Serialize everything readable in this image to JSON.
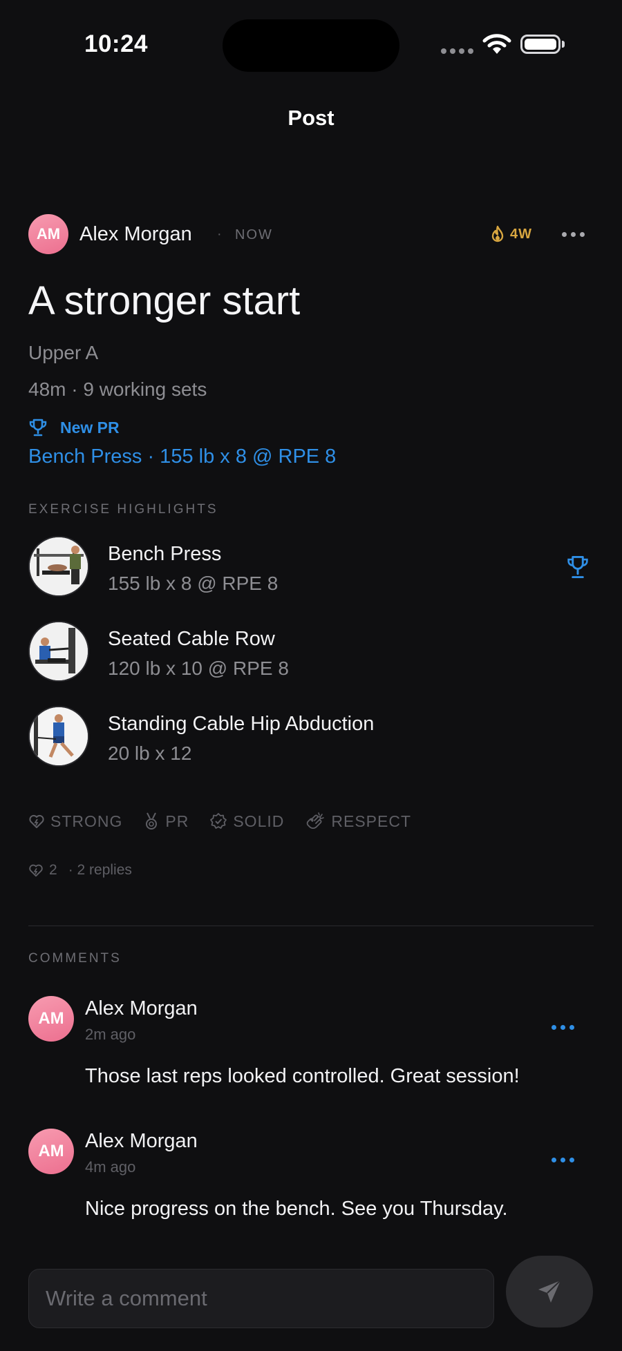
{
  "status_bar": {
    "time": "10:24"
  },
  "nav": {
    "title": "Post"
  },
  "post": {
    "author": {
      "name": "Alex Morgan",
      "initials": "AM"
    },
    "separator": "·",
    "posted": "NOW",
    "streak": "4W",
    "title": "A stronger start",
    "workout": "Upper A",
    "meta": "48m · 9 working sets",
    "pr_label": "New PR",
    "pr_detail": "Bench Press · 155 lb x 8 @ RPE 8"
  },
  "highlights": {
    "label": "EXERCISE HIGHLIGHTS",
    "items": [
      {
        "name": "Bench Press",
        "set": "155 lb x 8 @ RPE 8",
        "is_pr": true
      },
      {
        "name": "Seated Cable Row",
        "set": "120 lb x 10 @ RPE 8",
        "is_pr": false
      },
      {
        "name": "Standing Cable Hip Abduction",
        "set": "20 lb x 12",
        "is_pr": false
      }
    ]
  },
  "reactions": [
    {
      "label": "STRONG",
      "icon": "heart-bolt-icon"
    },
    {
      "label": "PR",
      "icon": "medal-icon"
    },
    {
      "label": "SOLID",
      "icon": "badge-check-icon"
    },
    {
      "label": "RESPECT",
      "icon": "clap-icon"
    }
  ],
  "stats": {
    "reaction_count": "2",
    "replies": "· 2 replies"
  },
  "comments": {
    "label": "COMMENTS",
    "items": [
      {
        "initials": "AM",
        "name": "Alex Morgan",
        "time": "2m ago",
        "text": "Those last reps looked controlled. Great session!"
      },
      {
        "initials": "AM",
        "name": "Alex Morgan",
        "time": "4m ago",
        "text": "Nice progress on the bench. See you Thursday."
      }
    ]
  },
  "composer": {
    "placeholder": "Write a comment",
    "send_icon": "send-icon"
  },
  "colors": {
    "accent": "#2f8fe6",
    "streak": "#d8a640",
    "background": "#0f0f11",
    "avatar": "#f08aa2"
  }
}
